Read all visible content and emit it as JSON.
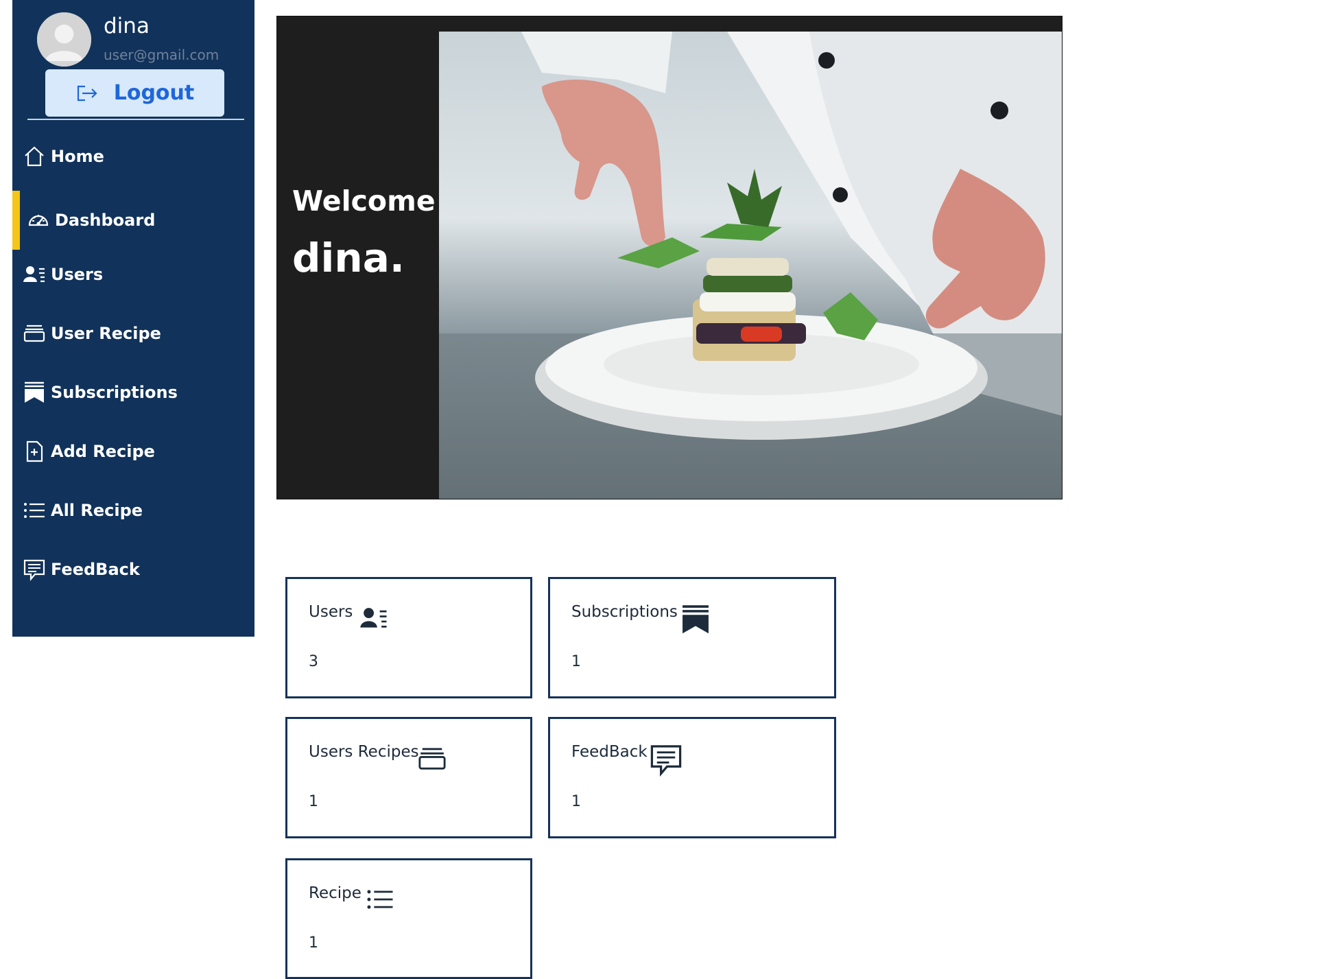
{
  "profile": {
    "name": "dina",
    "email": "user@gmail.com",
    "logout_label": "Logout"
  },
  "nav": {
    "items": [
      {
        "label": "Home",
        "icon": "home-icon"
      },
      {
        "label": "Dashboard",
        "icon": "speedometer-icon",
        "active": true
      },
      {
        "label": "Users",
        "icon": "person-lines-icon"
      },
      {
        "label": "User Recipe",
        "icon": "collection-icon"
      },
      {
        "label": "Subscriptions",
        "icon": "bookmarks-icon"
      },
      {
        "label": "Add Recipe",
        "icon": "file-plus-icon"
      },
      {
        "label": "All Recipe",
        "icon": "list-icon"
      },
      {
        "label": "FeedBack",
        "icon": "chat-text-icon"
      }
    ]
  },
  "hero": {
    "welcome": "Welcome!",
    "name": "dina."
  },
  "cards": [
    {
      "title": "Users",
      "value": "3",
      "icon": "person-lines-icon"
    },
    {
      "title": "Subscriptions",
      "value": "1",
      "icon": "bookmarks-icon"
    },
    {
      "title": "Users Recipes",
      "value": "1",
      "icon": "collection-icon"
    },
    {
      "title": "FeedBack",
      "value": "1",
      "icon": "chat-text-icon"
    },
    {
      "title": "Recipe",
      "value": "1",
      "icon": "list-icon"
    }
  ],
  "colors": {
    "sidebar": "#11325a",
    "active_marker": "#f5c518",
    "logout_bg": "#d7e9fb",
    "logout_text": "#1f66d9",
    "card_border": "#15325a"
  }
}
